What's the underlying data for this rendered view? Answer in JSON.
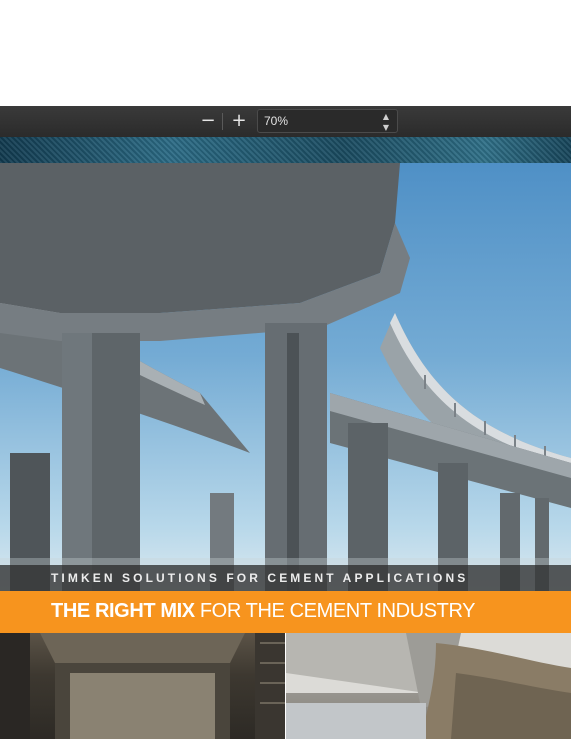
{
  "viewer": {
    "zoom_out_icon": "minus",
    "zoom_in_icon": "plus",
    "zoom_level": "70%"
  },
  "document": {
    "subtitle": "TIMKEN SOLUTIONS FOR CEMENT APPLICATIONS",
    "headline_bold": "THE RIGHT MIX",
    "headline_rest": " FOR THE CEMENT INDUSTRY",
    "colors": {
      "accent_orange": "#f7941e",
      "sky_blue": "#4f90c6",
      "toolbar_gray": "#333333"
    }
  }
}
